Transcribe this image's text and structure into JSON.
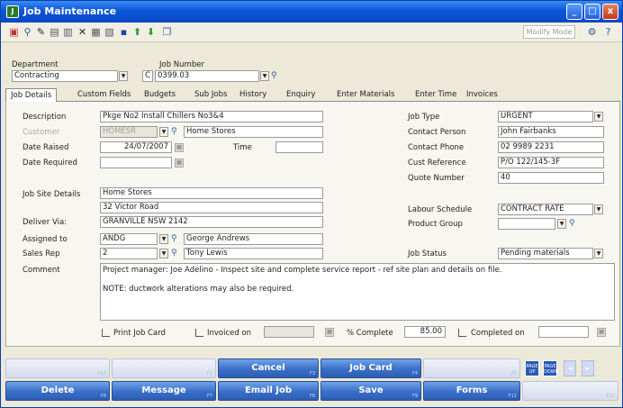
{
  "window": {
    "title": "Job Maintenance",
    "minimize": "_",
    "maximize": "□",
    "close": "x"
  },
  "toolbar": {
    "mode": "Modify Mode"
  },
  "header": {
    "department_label": "Department",
    "department_value": "Contracting",
    "job_number_label": "Job Number",
    "job_prefix": "C",
    "job_number_value": "0399.03"
  },
  "tabs": [
    "Job Details",
    "Custom Fields",
    "Budgets",
    "Sub Jobs",
    "History",
    "Enquiry",
    "Enter Materials",
    "Enter Time",
    "Invoices"
  ],
  "form": {
    "description_label": "Description",
    "description": "Pkge No2 Install Chillers No3&4",
    "customer_label": "Customer",
    "customer_code": "HOMESR",
    "customer_name": "Home Stores",
    "date_raised_label": "Date Raised",
    "date_raised": "24/07/2007",
    "time_label": "Time",
    "time": "",
    "date_required_label": "Date Required",
    "date_required": "",
    "job_site_label": "Job Site Details",
    "site_line1": "Home Stores",
    "site_line2": "32 Victor Road",
    "site_line3": "GRANVILLE  NSW  2142",
    "deliver_via_label": "Deliver Via:",
    "assigned_label": "Assigned to",
    "assigned_code": "ANDG",
    "assigned_name": "George Andrews",
    "sales_rep_label": "Sales Rep",
    "sales_rep_code": "2",
    "sales_rep_name": "Tony Lewis",
    "comment_label": "Comment",
    "comment_line1": "Project manager: Joe Adelino - Inspect site and complete service report - ref site plan and details on file.",
    "comment_line2": "NOTE:  ductwork alterations may also be required.",
    "job_type_label": "Job Type",
    "job_type": "URGENT",
    "contact_person_label": "Contact Person",
    "contact_person": "John Fairbanks",
    "contact_phone_label": "Contact Phone",
    "contact_phone": "02 9989 2231",
    "cust_ref_label": "Cust Reference",
    "cust_ref": "P/O 122/145-3F",
    "quote_label": "Quote Number",
    "quote": "40",
    "labour_label": "Labour Schedule",
    "labour": "CONTRACT RATE",
    "product_group_label": "Product Group",
    "product_group": "",
    "job_status_label": "Job Status",
    "job_status": "Pending materials",
    "print_job_card": "Print Job Card",
    "invoiced_on": "Invoiced on",
    "invoiced_date": "",
    "pct_complete_label": "% Complete",
    "pct_complete": "85.00",
    "completed_on": "Completed on",
    "completed_date": ""
  },
  "fkeys_row1": [
    {
      "label": "",
      "key": "F13"
    },
    {
      "label": "",
      "key": "F2"
    },
    {
      "label": "Cancel",
      "key": "F3"
    },
    {
      "label": "Job Card",
      "key": "F4"
    },
    {
      "label": "",
      "key": "F5"
    }
  ],
  "fkeys_row2": [
    {
      "label": "Delete",
      "key": "F6"
    },
    {
      "label": "Message",
      "key": "F7"
    },
    {
      "label": "Email Job",
      "key": "F8"
    },
    {
      "label": "Save",
      "key": "F9"
    },
    {
      "label": "Forms",
      "key": "F11"
    },
    {
      "label": "",
      "key": "F12"
    }
  ],
  "paging": {
    "page_up": "PAGE UP",
    "page_down": "PAGE DOWN"
  }
}
